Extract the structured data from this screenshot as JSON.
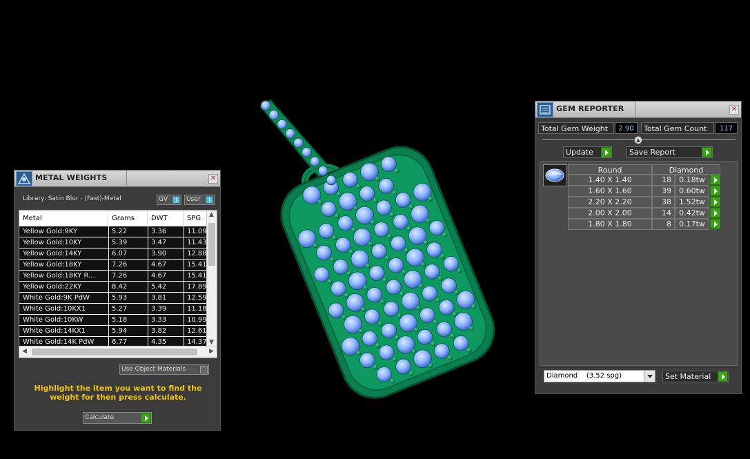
{
  "metal_weights": {
    "title": "METAL WEIGHTS",
    "library_label": "Library: Satin Blur - (Fast)-Metal",
    "gv_label": "GV",
    "user_label": "User",
    "toggle_glyph": "I",
    "columns": [
      "Metal",
      "Grams",
      "DWT",
      "SPG"
    ],
    "rows": [
      {
        "metal": "Yellow Gold:9KY",
        "grams": "5.22",
        "dwt": "3.36",
        "spg": "11.09"
      },
      {
        "metal": "Yellow Gold:10KY",
        "grams": "5.39",
        "dwt": "3.47",
        "spg": "11.43"
      },
      {
        "metal": "Yellow Gold:14KY",
        "grams": "6.07",
        "dwt": "3.90",
        "spg": "12.88"
      },
      {
        "metal": "Yellow Gold:18KY",
        "grams": "7.26",
        "dwt": "4.67",
        "spg": "15.41"
      },
      {
        "metal": "Yellow Gold:18KY R...",
        "grams": "7.26",
        "dwt": "4.67",
        "spg": "15.41"
      },
      {
        "metal": "Yellow Gold:22KY",
        "grams": "8.42",
        "dwt": "5.42",
        "spg": "17.89"
      },
      {
        "metal": "White Gold:9K PdW",
        "grams": "5.93",
        "dwt": "3.81",
        "spg": "12.59"
      },
      {
        "metal": "White Gold:10KX1",
        "grams": "5.27",
        "dwt": "3.39",
        "spg": "11.18"
      },
      {
        "metal": "White Gold:10KW",
        "grams": "5.18",
        "dwt": "3.33",
        "spg": "10.99"
      },
      {
        "metal": "White Gold:14KX1",
        "grams": "5.94",
        "dwt": "3.82",
        "spg": "12.61"
      },
      {
        "metal": "White Gold:14K PdW",
        "grams": "6.77",
        "dwt": "4.35",
        "spg": "14.37"
      }
    ],
    "use_object_materials": "Use Object Materials",
    "hint": "Highlight the item you want to find the weight for then press calculate.",
    "calculate_label": "Calculate",
    "close_glyph": "✕"
  },
  "gem_reporter": {
    "title": "GEM REPORTER",
    "total_weight_label": "Total Gem Weight",
    "total_weight_value": "2.90",
    "total_count_label": "Total Gem Count",
    "total_count_value": "117",
    "update_label": "Update",
    "save_report_label": "Save Report",
    "shape_header": "Round",
    "material_header": "Diamond",
    "gems": [
      {
        "size": "1.40 X 1.40",
        "count": "18",
        "weight": "0.18tw"
      },
      {
        "size": "1.60 X 1.60",
        "count": "39",
        "weight": "0.60tw"
      },
      {
        "size": "2.20 X 2.20",
        "count": "38",
        "weight": "1.52tw"
      },
      {
        "size": "2.00 X 2.00",
        "count": "14",
        "weight": "0.42tw"
      },
      {
        "size": "1.80 X 1.80",
        "count": "8",
        "weight": "0.17tw"
      }
    ],
    "material_select": "Diamond    (3.52 spg)",
    "set_material_label": "Set Material",
    "close_glyph": "✕",
    "collapse_glyph": "▲"
  },
  "colors": {
    "metal": "#0c8a56",
    "metal_dark": "#05522f",
    "gem": "#8ab4ff",
    "hint": "#f4c40f",
    "accent_green": "#3ca21c"
  }
}
